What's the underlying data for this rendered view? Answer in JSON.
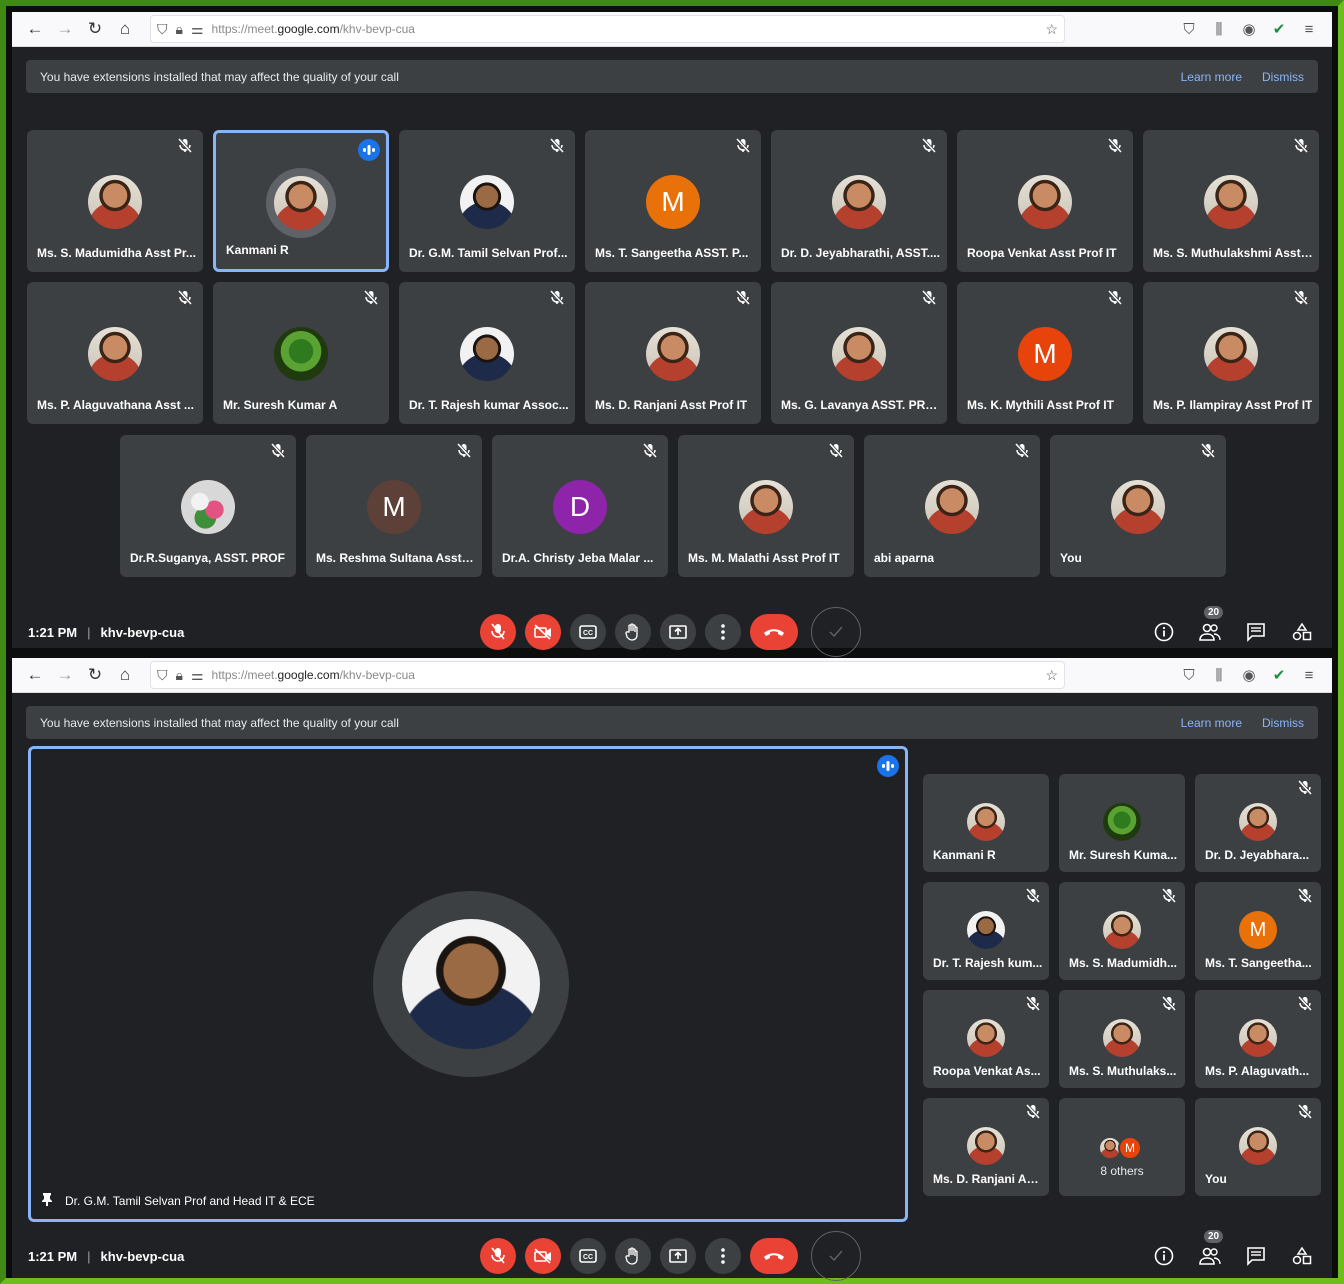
{
  "browser": {
    "url_prefix": "https://meet.",
    "url_domain": "google.com",
    "url_path": "/khv-bevp-cua"
  },
  "banner": {
    "text": "You have extensions installed that may affect the quality of your call",
    "learn_more": "Learn more",
    "dismiss": "Dismiss"
  },
  "meeting": {
    "time": "1:21 PM",
    "separator": "|",
    "code": "khv-bevp-cua",
    "participant_count": "20"
  },
  "grid_tiles": [
    {
      "name": "Ms. S. Madumidha Asst Pr...",
      "avatar": "photo"
    },
    {
      "name": "Kanmani R",
      "avatar": "photo",
      "speaking": true
    },
    {
      "name": "Dr. G.M. Tamil Selvan Prof...",
      "avatar": "photo-man"
    },
    {
      "name": "Ms. T. Sangeetha ASST. P...",
      "avatar": "letter",
      "letter": "M",
      "color": "#e8710a"
    },
    {
      "name": "Dr. D. Jeyabharathi, ASST....",
      "avatar": "photo"
    },
    {
      "name": "Roopa Venkat Asst Prof IT",
      "avatar": "photo"
    },
    {
      "name": "Ms. S. Muthulakshmi Asst ...",
      "avatar": "photo"
    },
    {
      "name": "Ms. P. Alaguvathana Asst ...",
      "avatar": "photo"
    },
    {
      "name": "Mr. Suresh Kumar A",
      "avatar": "photo-green"
    },
    {
      "name": "Dr. T. Rajesh kumar Assoc...",
      "avatar": "photo-man"
    },
    {
      "name": "Ms. D. Ranjani Asst Prof IT",
      "avatar": "photo"
    },
    {
      "name": "Ms. G. Lavanya ASST. PROF",
      "avatar": "photo"
    },
    {
      "name": "Ms. K. Mythili Asst Prof IT",
      "avatar": "letter",
      "letter": "M",
      "color": "#e8430a"
    },
    {
      "name": "Ms. P. Ilampiray Asst Prof IT",
      "avatar": "photo"
    },
    {
      "name": "Dr.R.Suganya, ASST. PROF",
      "avatar": "photo-flower"
    },
    {
      "name": "Ms. Reshma Sultana Asst. ...",
      "avatar": "letter",
      "letter": "M",
      "color": "#5d4037"
    },
    {
      "name": "Dr.A. Christy Jeba Malar ...",
      "avatar": "letter",
      "letter": "D",
      "color": "#8e24aa"
    },
    {
      "name": "Ms. M. Malathi Asst Prof IT",
      "avatar": "photo"
    },
    {
      "name": "abi aparna",
      "avatar": "photo"
    },
    {
      "name": "You",
      "avatar": "photo"
    }
  ],
  "spotlight": {
    "name": "Dr. G.M. Tamil Selvan Prof and Head IT & ECE"
  },
  "side_tiles": [
    {
      "name": "Kanmani R",
      "avatar": "photo"
    },
    {
      "name": "Mr. Suresh Kuma...",
      "avatar": "photo-green"
    },
    {
      "name": "Dr. D. Jeyabhara...",
      "avatar": "photo"
    },
    {
      "name": "Dr. T. Rajesh kum...",
      "avatar": "photo-man"
    },
    {
      "name": "Ms. S. Madumidh...",
      "avatar": "photo"
    },
    {
      "name": "Ms. T. Sangeetha...",
      "avatar": "letter",
      "letter": "M",
      "color": "#e8710a"
    },
    {
      "name": "Roopa Venkat As...",
      "avatar": "photo"
    },
    {
      "name": "Ms. S. Muthulaks...",
      "avatar": "photo"
    },
    {
      "name": "Ms. P. Alaguvath...",
      "avatar": "photo"
    },
    {
      "name": "Ms. D. Ranjani As...",
      "avatar": "photo"
    },
    {
      "name": "8 others",
      "avatar": "others",
      "letter": "M"
    },
    {
      "name": "You",
      "avatar": "photo"
    }
  ],
  "icons": [
    "back-icon",
    "forward-icon",
    "reload-icon",
    "home-icon",
    "shield-icon",
    "lock-icon",
    "permissions-icon",
    "star-icon",
    "pocket-icon",
    "library-icon",
    "extension-icon",
    "check-icon",
    "menu-icon",
    "mic-off-icon",
    "camera-off-icon",
    "captions-icon",
    "raise-hand-icon",
    "present-icon",
    "more-icon",
    "end-call-icon",
    "info-icon",
    "people-icon",
    "chat-icon",
    "activities-icon",
    "pin-icon",
    "speaking-icon"
  ]
}
